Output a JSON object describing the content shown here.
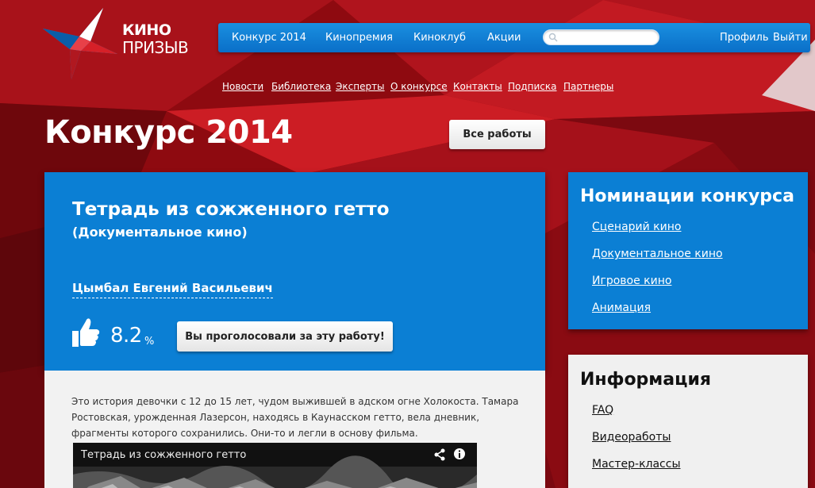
{
  "logo": {
    "line1": "КИНО",
    "line2": "ПРИЗЫВ"
  },
  "topnav": {
    "items": [
      "Конкурс 2014",
      "Кинопремия",
      "Киноклуб",
      "Акции"
    ],
    "search_placeholder": "",
    "profile": "Профиль",
    "logout": "Выйти"
  },
  "subnav": {
    "items": [
      "Новости",
      "Библиотека",
      "Эксперты",
      "О конкурсе",
      "Контакты",
      "Подписка",
      "Партнеры"
    ]
  },
  "page": {
    "title": "Конкурс 2014",
    "all_works_label": "Все работы"
  },
  "work": {
    "title": "Тетрадь из сожженного гетто",
    "genre": "(Документальное кино)",
    "author": "Цымбал Евгений Васильевич",
    "rating": "8.2",
    "rating_unit": "%",
    "voted_label": "Вы проголосовали за эту работу!",
    "description": "Это история девочки с 12 до 15 лет, чудом выжившей в адском огне Холокоста. Тамара Ростовская, урожденная Лазерсон, находясь в Каунасском гетто, вела дневник, фрагменты которого сохранились. Они-то и легли в основу фильма.",
    "video_title": "Тетрадь из сожженного гетто"
  },
  "nominations": {
    "title": "Номинации конкурса",
    "items": [
      "Сценарий кино",
      "Документальное кино",
      "Игровое кино",
      "Анимация"
    ]
  },
  "info": {
    "title": "Информация",
    "items": [
      "FAQ",
      "Видеоработы",
      "Мастер-классы"
    ]
  },
  "colors": {
    "background_red": "#9c0d12",
    "accent_blue": "#0b7fd4",
    "panel_gray": "#f2f2f2"
  }
}
